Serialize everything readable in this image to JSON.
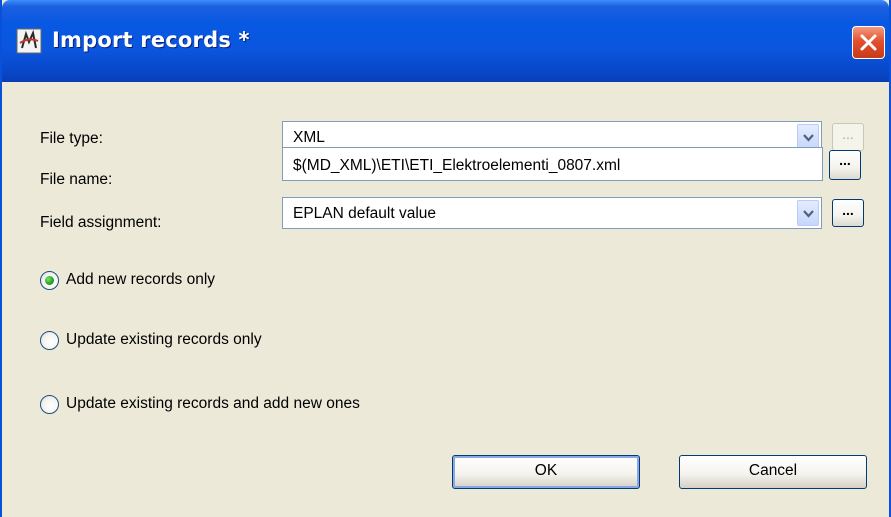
{
  "window": {
    "title": "Import records *",
    "app_icon": "eplan-app-icon",
    "close_icon": "close-icon",
    "accent_color": "#0A56DE",
    "close_color": "#E5502D"
  },
  "form": {
    "file_type": {
      "label": "File type:",
      "value": "XML",
      "browse_label": "..."
    },
    "file_name": {
      "label": "File name:",
      "value": "$(MD_XML)\\ETI\\ETI_Elektroelementi_0807.xml",
      "browse_label": "..."
    },
    "field_assignment": {
      "label": "Field assignment:",
      "value": "EPLAN default value",
      "browse_label": "..."
    }
  },
  "options": [
    {
      "label": "Add new records only",
      "selected": true
    },
    {
      "label": "Update existing records only",
      "selected": false
    },
    {
      "label": "Update existing records and add new ones",
      "selected": false
    }
  ],
  "buttons": {
    "ok": "OK",
    "cancel": "Cancel"
  }
}
